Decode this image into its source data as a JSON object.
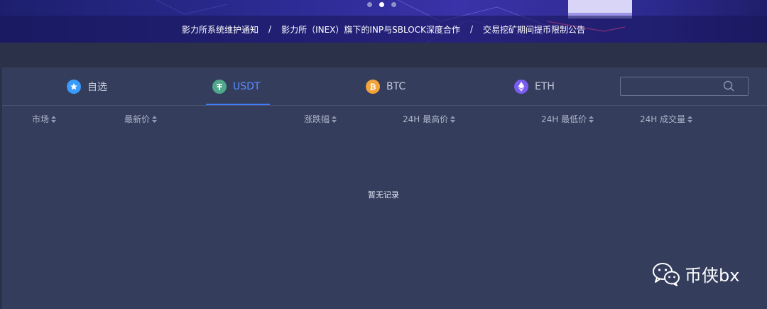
{
  "banner": {
    "carousel": {
      "count": 3,
      "active_index": 1
    },
    "notices": [
      "影力所系统维护通知",
      "影力所（INEX）旗下的INP与SBLOCK深度合作",
      "交易挖矿期间提币限制公告"
    ],
    "separator": "/"
  },
  "tabs": [
    {
      "label": "自选",
      "icon": "star-icon",
      "color": "#3a9bff",
      "active": false
    },
    {
      "label": "USDT",
      "icon": "usdt-icon",
      "color": "#4fa88a",
      "active": true
    },
    {
      "label": "BTC",
      "icon": "btc-icon",
      "color": "#f2a33a",
      "active": false
    },
    {
      "label": "ETH",
      "icon": "eth-icon",
      "color": "#7b5cf0",
      "active": false
    }
  ],
  "search": {
    "placeholder": "",
    "value": ""
  },
  "columns": [
    "市场",
    "最新价",
    "涨跌幅",
    "24H 最高价",
    "24H 最低价",
    "24H 成交量"
  ],
  "empty_message": "暂无记录",
  "watermark": {
    "text": "币侠bx"
  },
  "colors": {
    "accent": "#3d7bff",
    "panel": "#343d5c",
    "background": "#2a3149"
  }
}
